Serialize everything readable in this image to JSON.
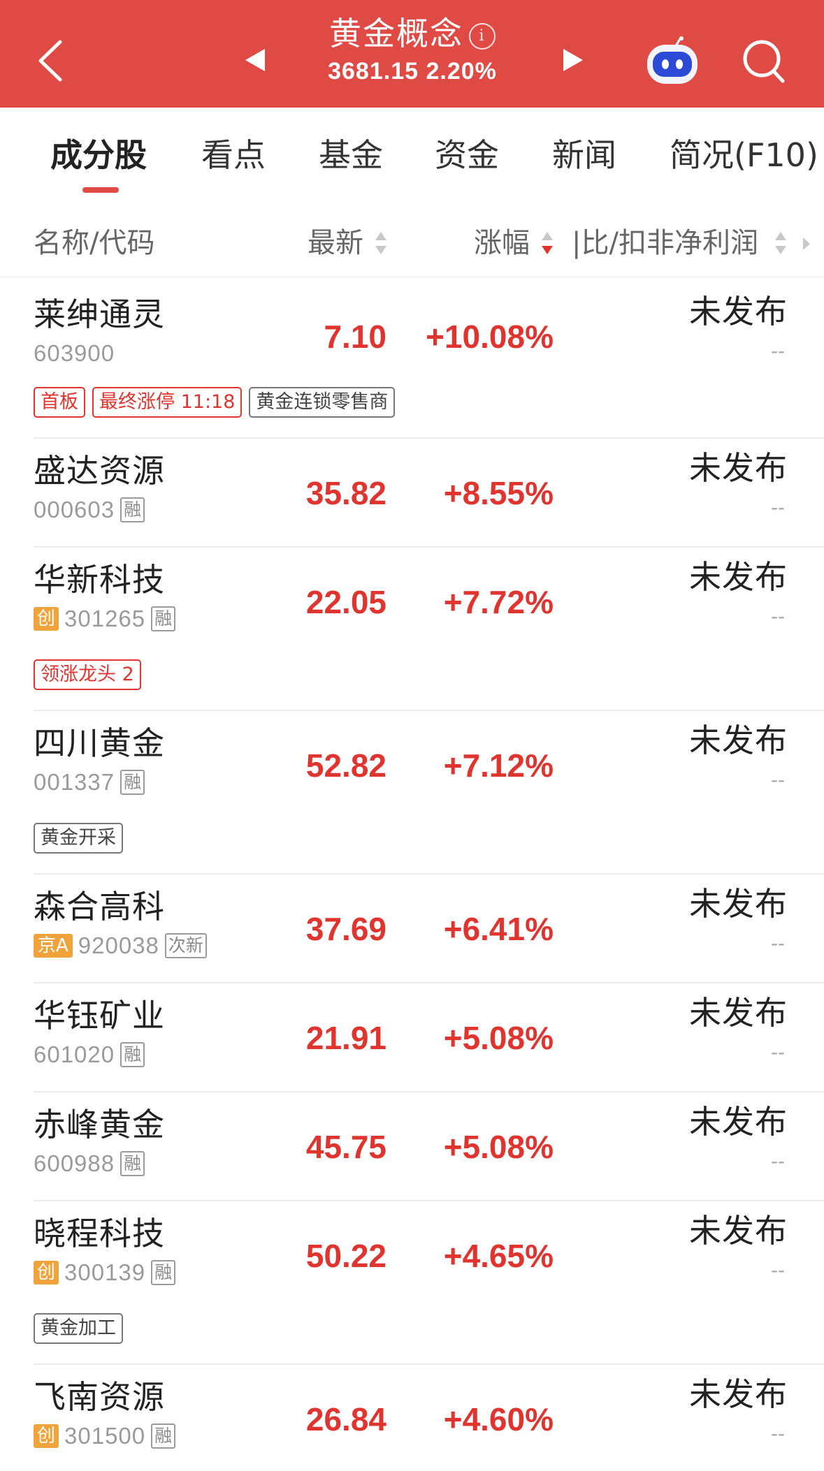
{
  "header": {
    "title": "黄金概念",
    "info": "i",
    "subtitle": "3681.15 2.20%",
    "colors": {
      "bar": "#e04a45",
      "accent": "#e0342f"
    }
  },
  "tabs": [
    {
      "label": "成分股",
      "active": true
    },
    {
      "label": "看点"
    },
    {
      "label": "基金"
    },
    {
      "label": "资金"
    },
    {
      "label": "新闻"
    },
    {
      "label": "简况(F10)"
    }
  ],
  "columns": {
    "name_code": "名称/代码",
    "latest": "最新",
    "change": "涨幅",
    "profit": "比/扣非净利润"
  },
  "rows": [
    {
      "name": "莱绅通灵",
      "code": "603900",
      "price": "7.10",
      "change": "+10.08%",
      "status": "未发布",
      "sub": "--",
      "tags": [
        {
          "text": "首板",
          "style": "red"
        },
        {
          "text": "最终涨停 11:18",
          "style": "red"
        },
        {
          "text": "黄金连锁零售商",
          "style": "gray"
        }
      ]
    },
    {
      "name": "盛达资源",
      "code": "000603",
      "rong": "融",
      "price": "35.82",
      "change": "+8.55%",
      "status": "未发布",
      "sub": "--"
    },
    {
      "name": "华新科技",
      "chuang": "创",
      "code": "301265",
      "rong": "融",
      "price": "22.05",
      "change": "+7.72%",
      "status": "未发布",
      "sub": "--",
      "tags": [
        {
          "text": "领涨龙头 2",
          "style": "red"
        }
      ]
    },
    {
      "name": "四川黄金",
      "code": "001337",
      "rong": "融",
      "price": "52.82",
      "change": "+7.12%",
      "status": "未发布",
      "sub": "--",
      "tags": [
        {
          "text": "黄金开采",
          "style": "gray"
        }
      ]
    },
    {
      "name": "森合高科",
      "jing": "京A",
      "code": "920038",
      "rong": "次新",
      "price": "37.69",
      "change": "+6.41%",
      "status": "未发布",
      "sub": "--"
    },
    {
      "name": "华钰矿业",
      "code": "601020",
      "rong": "融",
      "price": "21.91",
      "change": "+5.08%",
      "status": "未发布",
      "sub": "--"
    },
    {
      "name": "赤峰黄金",
      "code": "600988",
      "rong": "融",
      "price": "45.75",
      "change": "+5.08%",
      "status": "未发布",
      "sub": "--"
    },
    {
      "name": "晓程科技",
      "chuang": "创",
      "code": "300139",
      "rong": "融",
      "price": "50.22",
      "change": "+4.65%",
      "status": "未发布",
      "sub": "--",
      "tags": [
        {
          "text": "黄金加工",
          "style": "gray"
        }
      ]
    },
    {
      "name": "飞南资源",
      "chuang": "创",
      "code": "301500",
      "rong": "融",
      "price": "26.84",
      "change": "+4.60%",
      "status": "未发布",
      "sub": "--"
    }
  ]
}
